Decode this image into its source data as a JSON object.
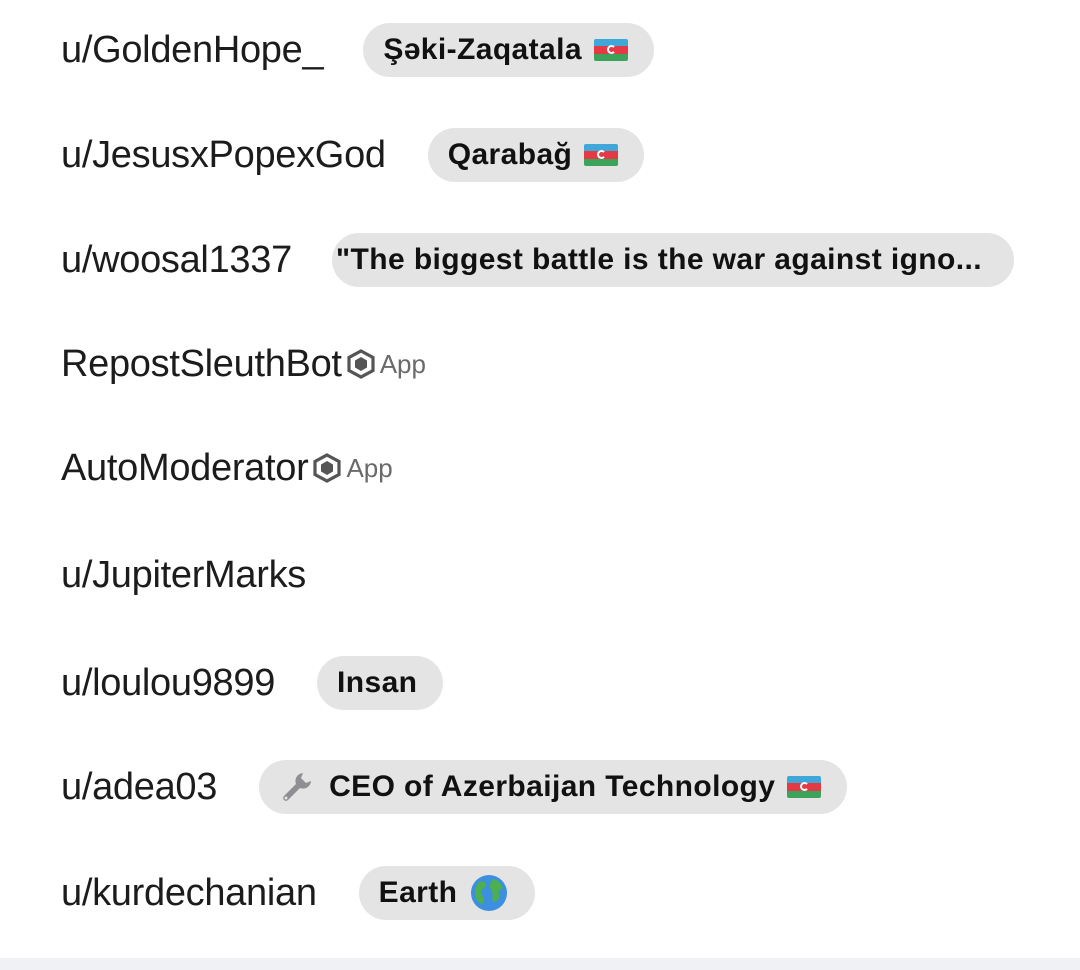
{
  "users": [
    {
      "username": "u/GoldenHope_",
      "flair": "Şəki-Zaqatala",
      "flair_icon": "azerbaijan-flag-icon"
    },
    {
      "username": "u/JesusxPopexGod",
      "flair": "Qarabağ",
      "flair_icon": "azerbaijan-flag-icon"
    },
    {
      "username": "u/woosal1337",
      "flair": "\"The biggest battle is the war against igno..."
    },
    {
      "username": "RepostSleuthBot",
      "badge": "App",
      "badge_icon": "app-hexagon-icon"
    },
    {
      "username": "AutoModerator",
      "badge": "App",
      "badge_icon": "app-hexagon-icon"
    },
    {
      "username": "u/JupiterMarks"
    },
    {
      "username": "u/loulou9899",
      "flair": "Insan"
    },
    {
      "username": "u/adea03",
      "flair": "CEO of Azerbaijan Technology",
      "flair_leading_icon": "wrench-icon",
      "flair_icon": "azerbaijan-flag-icon"
    },
    {
      "username": "u/kurdechanian",
      "flair": "Earth",
      "flair_icon": "globe-icon"
    }
  ],
  "colors": {
    "flair_background": "#e4e4e4",
    "username_text": "#1c1c1c",
    "app_badge_text": "#6a6a6a",
    "bottom_bar": "#eff1f4"
  }
}
